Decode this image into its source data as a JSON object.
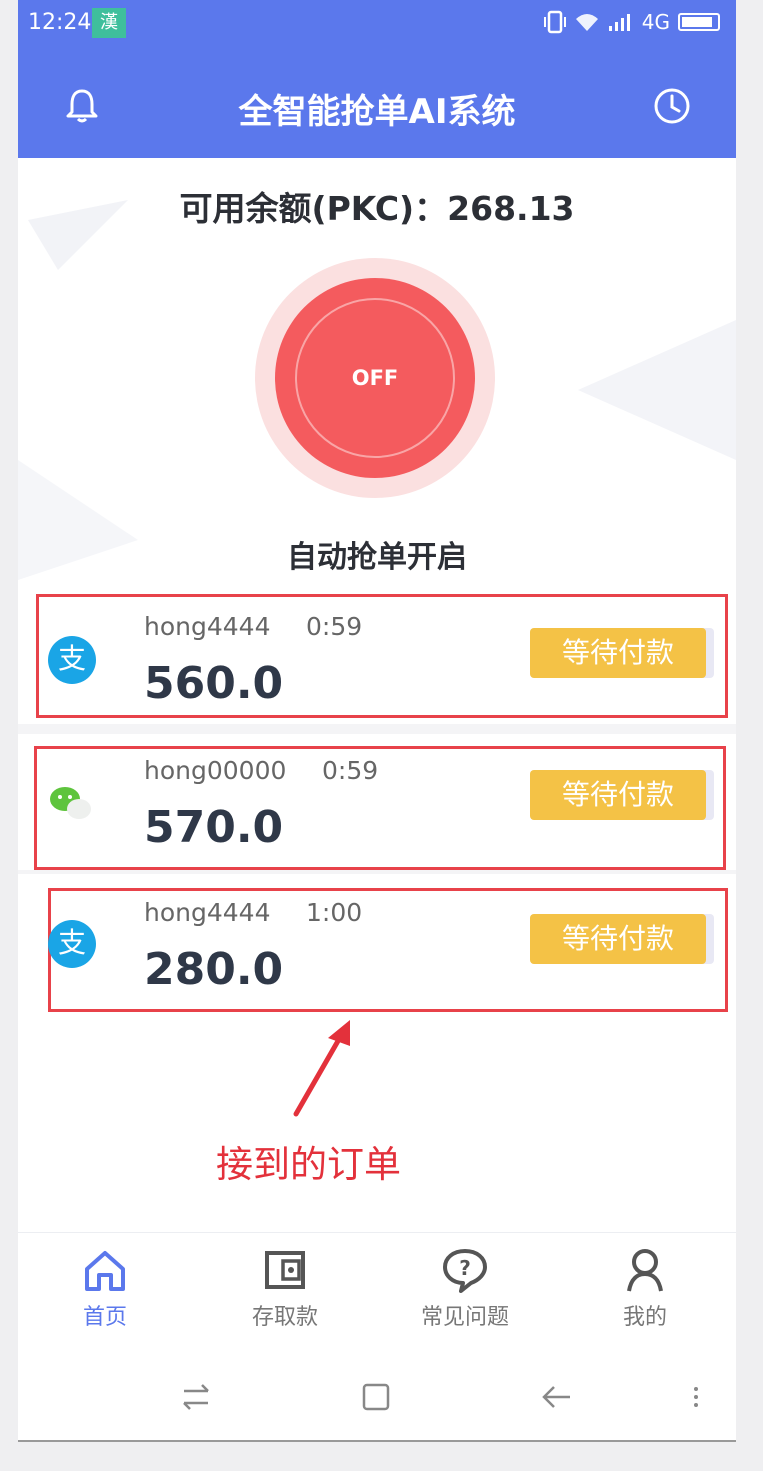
{
  "status_bar": {
    "time": "12:24",
    "app_badge": "漢",
    "network": "4G"
  },
  "header": {
    "title": "全智能抢单AI系统"
  },
  "balance": {
    "text": "可用余额(PKC)：268.13"
  },
  "toggle": {
    "label": "OFF"
  },
  "auto_label": "自动抢单开启",
  "orders": [
    {
      "payment": "alipay-icon",
      "icon_glyph": "支",
      "user": "hong4444",
      "time": "0:59",
      "amount": "560.0",
      "status": "等待付款"
    },
    {
      "payment": "wechat-icon",
      "icon_glyph": "",
      "user": "hong00000",
      "time": "0:59",
      "amount": "570.0",
      "status": "等待付款"
    },
    {
      "payment": "alipay-icon",
      "icon_glyph": "支",
      "user": "hong4444",
      "time": "1:00",
      "amount": "280.0",
      "status": "等待付款"
    }
  ],
  "annotation": {
    "text": "接到的订单",
    "color": "#e3313b"
  },
  "bottom_nav": [
    {
      "label": "首页",
      "icon": "home-icon",
      "active": true
    },
    {
      "label": "存取款",
      "icon": "wallet-icon",
      "active": false
    },
    {
      "label": "常见问题",
      "icon": "question-icon",
      "active": false
    },
    {
      "label": "我的",
      "icon": "user-icon",
      "active": false
    }
  ],
  "colors": {
    "primary": "#5b78ec",
    "toggle": "#f45b5e",
    "status_button": "#f4c246",
    "highlight_box": "#e8424a"
  }
}
